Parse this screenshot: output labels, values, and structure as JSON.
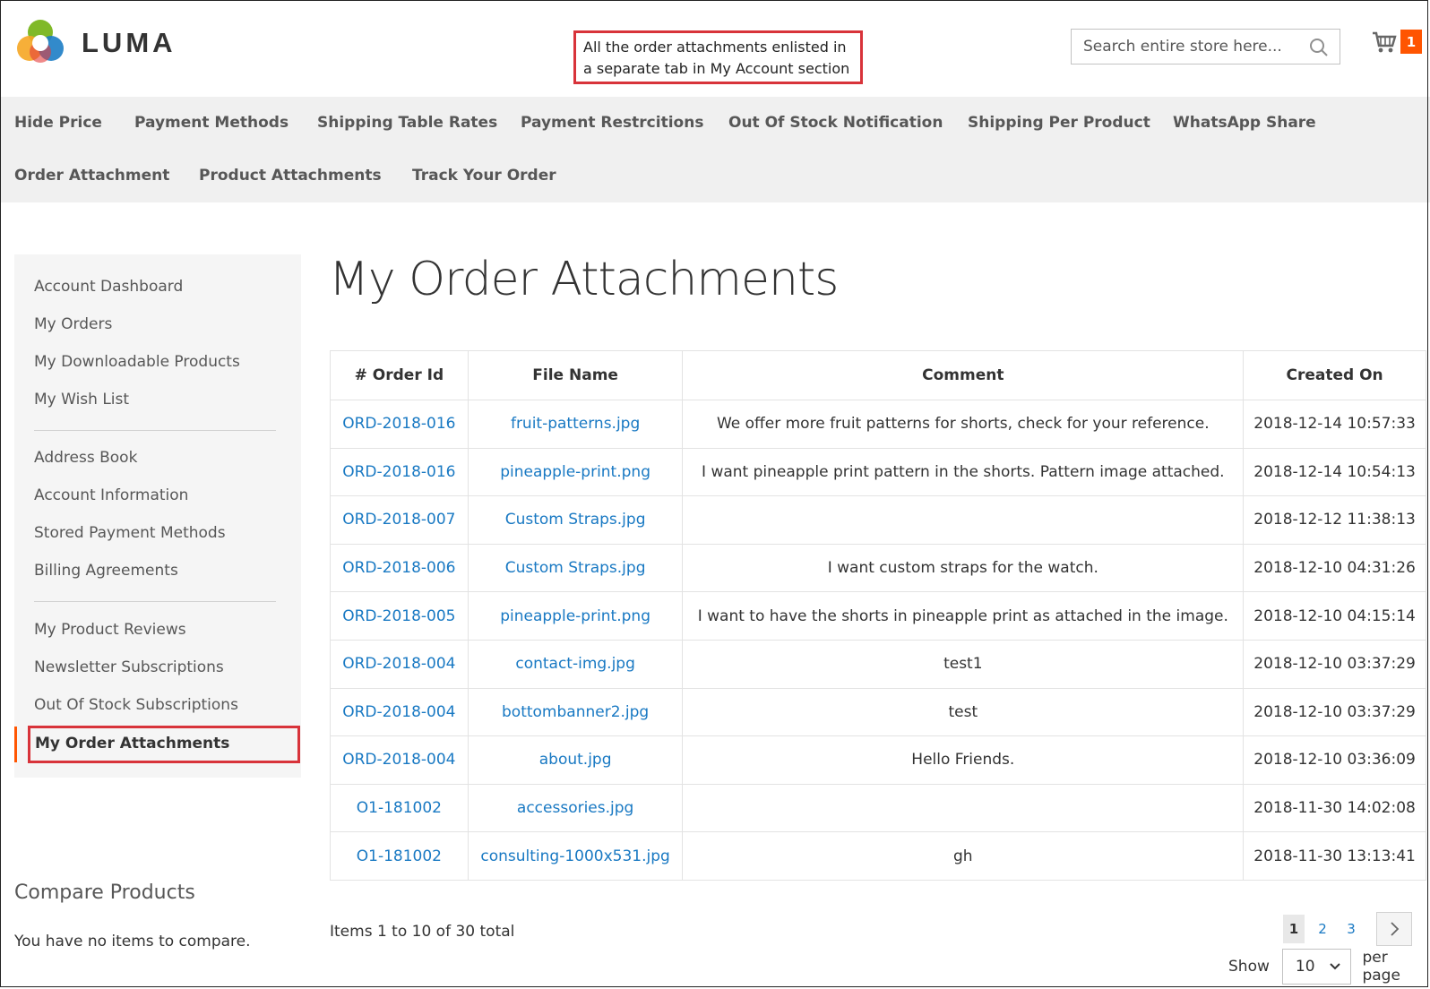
{
  "header": {
    "logo_text": "LUMA",
    "callout_line1": "All the order attachments enlisted in",
    "callout_line2": "a separate tab in My Account section",
    "search_placeholder": "Search entire store here...",
    "cart_count": "1"
  },
  "nav": {
    "items": [
      "Hide Price",
      "Payment Methods",
      "Shipping Table Rates",
      "Payment Restrcitions",
      "Out Of Stock Notification",
      "Shipping Per Product",
      "WhatsApp Share",
      "Order Attachment",
      "Product Attachments",
      "Track Your Order"
    ]
  },
  "sidebar": {
    "items": [
      "Account Dashboard",
      "My Orders",
      "My Downloadable Products",
      "My Wish List",
      "Address Book",
      "Account Information",
      "Stored Payment Methods",
      "Billing Agreements",
      "My Product Reviews",
      "Newsletter Subscriptions",
      "Out Of Stock Subscriptions"
    ],
    "active_item": "My Order Attachments"
  },
  "compare": {
    "title": "Compare Products",
    "empty_text": "You have no items to compare."
  },
  "main": {
    "title": "My Order Attachments",
    "columns": [
      "# Order Id",
      "File Name",
      "Comment",
      "Created On"
    ],
    "rows": [
      {
        "order_id": "ORD-2018-016",
        "file": "fruit-patterns.jpg",
        "comment": "We offer more fruit patterns for shorts, check for your reference.",
        "created": "2018-12-14 10:57:33"
      },
      {
        "order_id": "ORD-2018-016",
        "file": "pineapple-print.png",
        "comment": "I want pineapple print pattern in the shorts. Pattern image attached.",
        "created": "2018-12-14 10:54:13"
      },
      {
        "order_id": "ORD-2018-007",
        "file": "Custom Straps.jpg",
        "comment": "",
        "created": "2018-12-12 11:38:13"
      },
      {
        "order_id": "ORD-2018-006",
        "file": "Custom Straps.jpg",
        "comment": "I want custom straps for the watch.",
        "created": "2018-12-10 04:31:26"
      },
      {
        "order_id": "ORD-2018-005",
        "file": "pineapple-print.png",
        "comment": "I want to have the shorts in pineapple print as attached in the image.",
        "created": "2018-12-10 04:15:14"
      },
      {
        "order_id": "ORD-2018-004",
        "file": "contact-img.jpg",
        "comment": "test1",
        "created": "2018-12-10 03:37:29"
      },
      {
        "order_id": "ORD-2018-004",
        "file": "bottombanner2.jpg",
        "comment": "test",
        "created": "2018-12-10 03:37:29"
      },
      {
        "order_id": "ORD-2018-004",
        "file": "about.jpg",
        "comment": "Hello Friends.",
        "created": "2018-12-10 03:36:09"
      },
      {
        "order_id": "O1-181002",
        "file": "accessories.jpg",
        "comment": "",
        "created": "2018-11-30 14:02:08"
      },
      {
        "order_id": "O1-181002",
        "file": "consulting-1000x531.jpg",
        "comment": "gh",
        "created": "2018-11-30 13:13:41"
      }
    ],
    "items_total": "Items 1 to 10 of 30 total",
    "pages": [
      "1",
      "2",
      "3"
    ],
    "show_label": "Show",
    "limit_value": "10",
    "per_page_label": "per page"
  },
  "colors": {
    "link": "#1979c3",
    "accent": "#ff5501",
    "callout_border": "#d8333a",
    "nav_bg": "#f0f0f0"
  },
  "icons": [
    "luma-logo-icon",
    "search-icon",
    "cart-icon",
    "chevron-right-icon",
    "chevron-down-icon"
  ]
}
